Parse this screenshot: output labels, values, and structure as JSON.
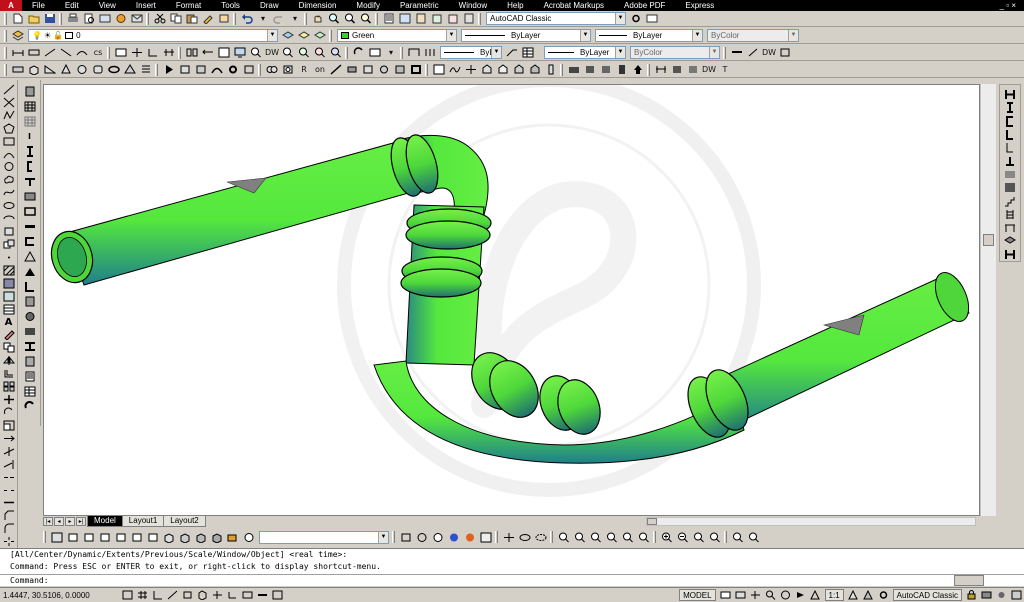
{
  "app": {
    "logo": "A",
    "workspace": "AutoCAD Classic"
  },
  "menu": [
    "File",
    "Edit",
    "View",
    "Insert",
    "Format",
    "Tools",
    "Draw",
    "Dimension",
    "Modify",
    "Parametric",
    "Window",
    "Help",
    "Acrobat Markups",
    "Adobe PDF",
    "Express"
  ],
  "window_controls": "_ ▫ ×",
  "layers": {
    "current_layer": "0",
    "color": "Green",
    "linetype": "ByLayer",
    "lineweight": "ByLayer",
    "plotstyle": "ByColor"
  },
  "tab_nav": [
    "|◂",
    "◂",
    "▸",
    "▸|"
  ],
  "tabs": [
    {
      "label": "Model",
      "active": true
    },
    {
      "label": "Layout1",
      "active": false
    },
    {
      "label": "Layout2",
      "active": false
    }
  ],
  "command": {
    "history_line_1": "[All/Center/Dynamic/Extents/Previous/Scale/Window/Object] <real time>:",
    "history_line_2": "Command: Press ESC or ENTER to exit, or right-click to display shortcut-menu.",
    "prompt": "Command:"
  },
  "status": {
    "coordinates": "1.4447, 30.5106, 0.0000",
    "space": "MODEL",
    "annotation_scale": "1:1",
    "workspace": "AutoCAD Classic"
  },
  "toolbar_labels": {
    "dw": "DW",
    "cs": "cs",
    "r": "R",
    "on": "on",
    "t": "T"
  },
  "colors": {
    "pipe_green": "#55e83d",
    "pipe_shadow": "#1f7f8a",
    "canvas_bg": "#ffffff",
    "menubar_bg": "#000000"
  }
}
